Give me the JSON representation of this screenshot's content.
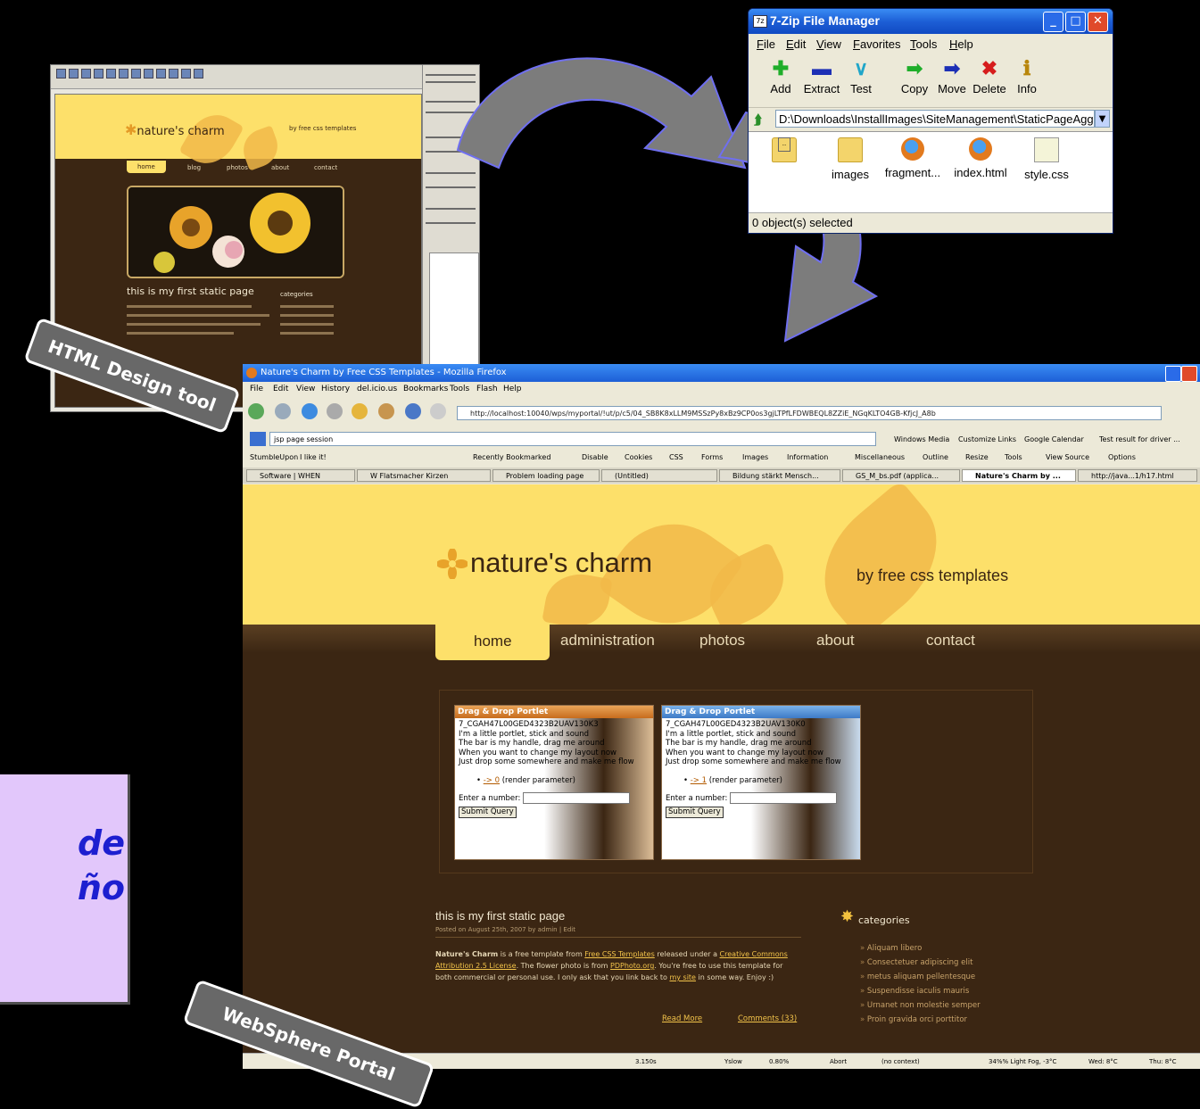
{
  "design_tool": {
    "site_name": "nature's charm",
    "byline": "by free css templates",
    "nav": [
      "home",
      "blog",
      "photos",
      "about",
      "contact"
    ],
    "post_title": "this is my first static page",
    "categories_title": "categories"
  },
  "sevenzip": {
    "title": "7-Zip File Manager",
    "menu": [
      "File",
      "Edit",
      "View",
      "Favorites",
      "Tools",
      "Help"
    ],
    "tools": [
      {
        "label": "Add",
        "icon": "plus-icon",
        "color": "#1fae2a"
      },
      {
        "label": "Extract",
        "icon": "minus-icon",
        "color": "#1c2fb5"
      },
      {
        "label": "Test",
        "icon": "check-icon",
        "color": "#20a6c9"
      },
      {
        "label": "Copy",
        "icon": "copy-arrow-icon",
        "color": "#1fae2a"
      },
      {
        "label": "Move",
        "icon": "move-arrow-icon",
        "color": "#1c2fb5"
      },
      {
        "label": "Delete",
        "icon": "delete-x-icon",
        "color": "#d61d1d"
      },
      {
        "label": "Info",
        "icon": "info-icon",
        "color": "#b8860b"
      }
    ],
    "path": "D:\\Downloads\\InstallImages\\SiteManagement\\StaticPageAggr",
    "files": [
      "..",
      "images",
      "fragment...",
      "index.html",
      "style.css"
    ],
    "status": "0 object(s) selected"
  },
  "firefox": {
    "title": "Nature's Charm by Free CSS Templates - Mozilla Firefox",
    "menu": [
      "File",
      "Edit",
      "View",
      "History",
      "del.icio.us",
      "Bookmarks",
      "Tools",
      "Flash",
      "Help"
    ],
    "url": "http://localhost:10040/wps/myportal/!ut/p/c5/04_SB8K8xLLM9MSSzPy8xBz9CP0os3gjLTPfLFDWBEQL8ZZiE_NGqKLTO4GB-KfjcJ_A8b",
    "search_text": "jsp page session",
    "bookmarks_row1": [
      "StumbleUpon",
      "I like it!",
      "Recently Bookmarked",
      "Disable",
      "Cookies",
      "CSS",
      "Forms",
      "Images",
      "Information",
      "Miscellaneous",
      "Outline",
      "Resize",
      "Tools",
      "View Source",
      "Options"
    ],
    "bookmarks_row2": [
      "Windows Media",
      "Customize Links",
      "Google Calendar",
      "Test result for driver ..."
    ],
    "tabs": [
      "Software | WHEN",
      "W Flatsmacher Kirzen",
      "Problem loading page",
      "(Untitled)",
      "Bildung stärkt Mensch...",
      "GS_M_bs.pdf (applica...",
      "Nature's Charm by ...",
      "http://java...1/h17.html"
    ],
    "status_items": [
      "3.150s",
      "Yslow",
      "0.80%",
      "Abort",
      "(no context)",
      "34%% Light Fog, -3°C",
      "Wed: 8°C",
      "Thu: 8°C"
    ]
  },
  "page": {
    "site_name": "nature's charm",
    "byline": "by free css templates",
    "nav": [
      "home",
      "administration",
      "photos",
      "about",
      "contact"
    ],
    "portlets": [
      {
        "header": "Drag & Drop Portlet",
        "id": "7_CGAH47L00GED4323B2UAV130K3",
        "lines": [
          "I'm a little portlet, stick and sound",
          "The bar is my handle, drag me around",
          "When you want to change my layout now",
          "Just drop some somewhere and make me flow"
        ],
        "link": "-> 0",
        "link_suffix": "(render parameter)",
        "input_label": "Enter a number:",
        "button": "Submit Query"
      },
      {
        "header": "Drag & Drop Portlet",
        "id": "7_CGAH47L00GED4323B2UAV130K0",
        "lines": [
          "I'm a little portlet, stick and sound",
          "The bar is my handle, drag me around",
          "When you want to change my layout now",
          "Just drop some somewhere and make me flow"
        ],
        "link": "-> 1",
        "link_suffix": "(render parameter)",
        "input_label": "Enter a number:",
        "button": "Submit Query"
      }
    ],
    "post": {
      "title": "this is my first static page",
      "meta": "Posted on August 25th, 2007 by admin | Edit",
      "body_prefix": "Nature's Charm",
      "body_1": " is a free template from ",
      "link_1": "Free CSS Templates",
      "body_2": " released under a ",
      "link_2": "Creative Commons Attribution 2.5 License",
      "body_3": ". The flower photo is from ",
      "link_3": "PDPhoto.org",
      "body_4": ". You're free to use this template for both commercial or personal use. I only ask that you link back to ",
      "link_4": "my site",
      "body_5": " in some way. Enjoy :)",
      "read_more": "Read More",
      "comments": "Comments (33)"
    },
    "categories": {
      "title": "categories",
      "items": [
        "Aliquam libero",
        "Consectetuer adipiscing elit",
        "metus aliquam pellentesque",
        "Suspendisse iaculis mauris",
        "Urnanet non molestie semper",
        "Proin gravida orci porttitor"
      ]
    }
  },
  "labels": {
    "html_tool": "HTML Design tool",
    "websphere": "WebSphere Portal",
    "lilac_line1": "de",
    "lilac_line2": "ño"
  },
  "colors": {
    "arrow_fill": "#7c7c7c",
    "arrow_stroke": "#6f6ff0",
    "page_brown": "#3b2613",
    "page_yellow": "#fde06a",
    "lilac": "#e2c7fb",
    "lilac_text": "#1d1fd0"
  }
}
